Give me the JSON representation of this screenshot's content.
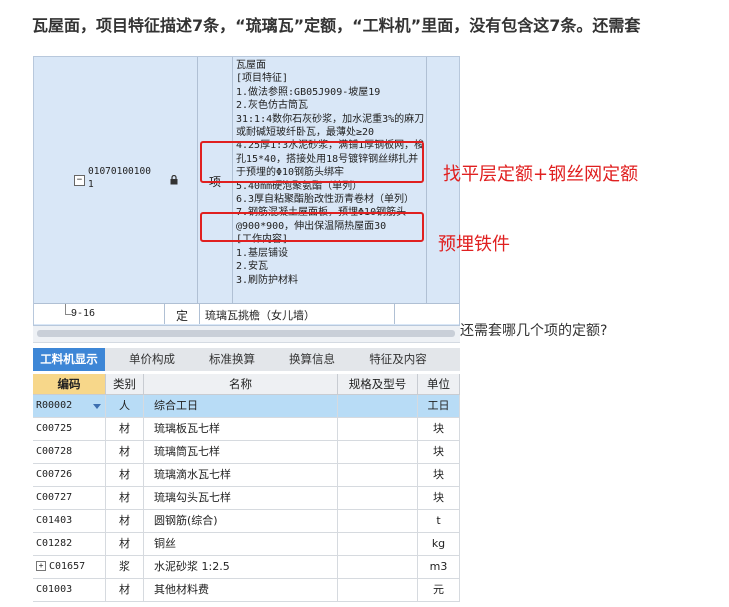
{
  "question": "瓦屋面，项目特征描述7条，“琉璃瓦”定额，“工料机”里面，没有包含这7条。还需套",
  "question_cont": "还需套哪几个项的定额?",
  "item_row": {
    "code_line1": "01070100100",
    "code_line2": "1",
    "type": "项",
    "description_lines": [
      "瓦屋面",
      "[项目特征]",
      "1.做法参照:GB05J909-坡屋19",
      "2.灰色仿古筒瓦",
      "31:1:4数你石灰砂浆，加水泥重3%的麻刀",
      "或耐碱短玻纤卧瓦，最薄处≥20",
      "4.25厚1:3水泥砂浆，满铺1厚钢板网，梭",
      "孔15*40，搭接处用18号镀锌钢丝绑扎并",
      "于预埋的Φ10钢筋头绑牢",
      "5.40mm硬泡聚氨酯（单列）",
      "6.3厚自粘聚酯胎改性沥青卷材（单列）",
      "7.钢筋混凝土屋面板，预埋Φ10钢筋头",
      "@900*900，伸出保温隔热屋面30",
      "[工作内容]",
      "1.基层铺设",
      "2.安瓦",
      "3.刷防护材料"
    ]
  },
  "quota_row": {
    "code": "9-16",
    "type": "定",
    "name": "琉璃瓦挑檐（女儿墙）"
  },
  "annotations": {
    "box1_label": "找平层定额+钢丝网定额",
    "box2_label": "预埋铁件"
  },
  "tabs": [
    "工料机显示",
    "单价构成",
    "标准换算",
    "换算信息",
    "特征及内容"
  ],
  "grid": {
    "headers": [
      "编码",
      "类别",
      "名称",
      "规格及型号",
      "单位"
    ],
    "rows": [
      {
        "code": "R00002",
        "category": "人",
        "name": "综合工日",
        "spec": "",
        "unit": "工日"
      },
      {
        "code": "C00725",
        "category": "材",
        "name": "琉璃板瓦七样",
        "spec": "",
        "unit": "块"
      },
      {
        "code": "C00728",
        "category": "材",
        "name": "琉璃筒瓦七样",
        "spec": "",
        "unit": "块"
      },
      {
        "code": "C00726",
        "category": "材",
        "name": "琉璃滴水瓦七样",
        "spec": "",
        "unit": "块"
      },
      {
        "code": "C00727",
        "category": "材",
        "name": "琉璃勾头瓦七样",
        "spec": "",
        "unit": "块"
      },
      {
        "code": "C01403",
        "category": "材",
        "name": "圆钢筋(综合)",
        "spec": "",
        "unit": "t"
      },
      {
        "code": "C01282",
        "category": "材",
        "name": "铜丝",
        "spec": "",
        "unit": "kg"
      },
      {
        "code": "C01657",
        "category": "浆",
        "name": "水泥砂浆 1:2.5",
        "spec": "",
        "unit": "m3"
      },
      {
        "code": "C01003",
        "category": "材",
        "name": "其他材料费",
        "spec": "",
        "unit": "元"
      }
    ]
  },
  "colors": {
    "accent": "#3d86d6",
    "highlight": "#e02020",
    "selected_row": "#b8dcf6"
  }
}
